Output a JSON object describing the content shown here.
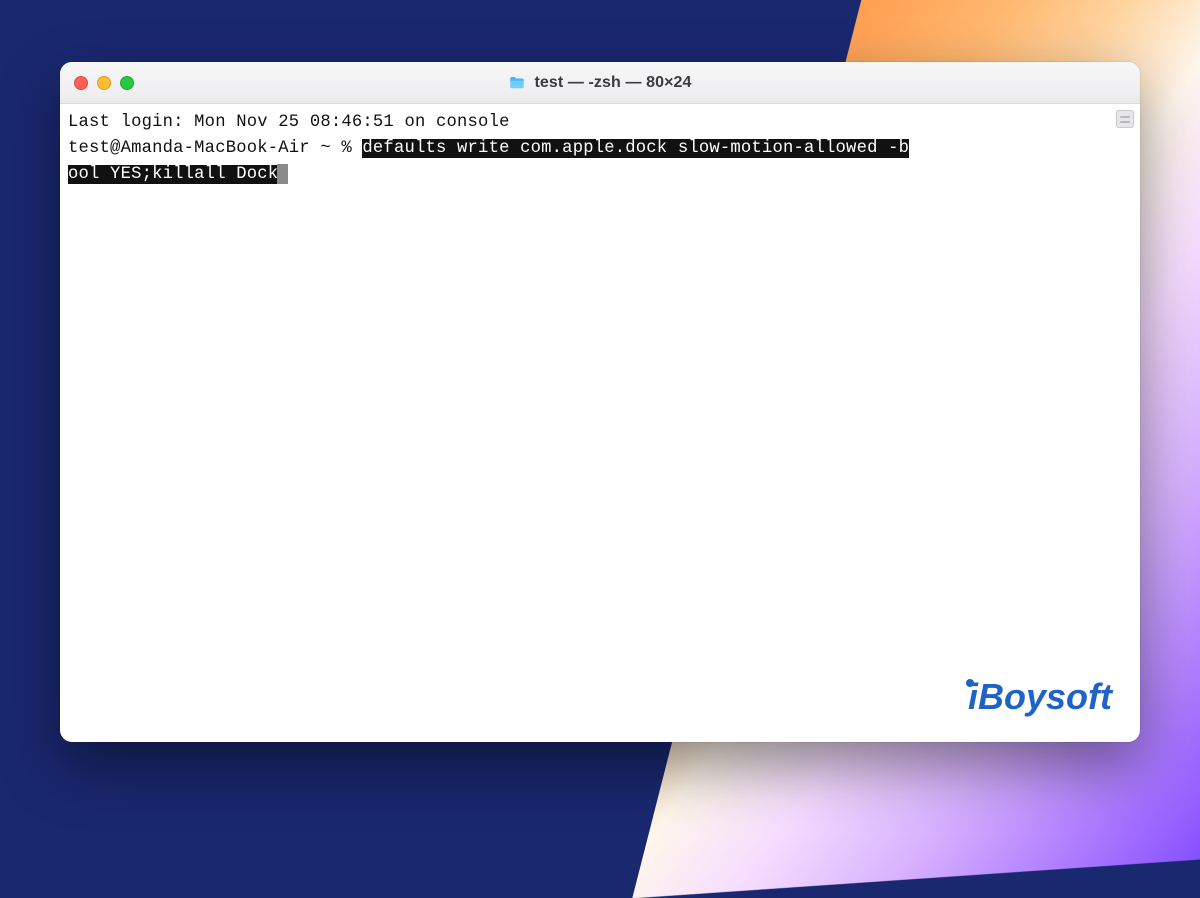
{
  "window": {
    "title": "test — -zsh — 80×24",
    "folder_icon": "folder-icon"
  },
  "terminal": {
    "last_login_line": "Last login: Mon Nov 25 08:46:51 on console",
    "prompt": "test@Amanda-MacBook-Air ~ % ",
    "command_selected_part1": "defaults write com.apple.dock slow-motion-allowed -b",
    "command_selected_part2": "ool YES;killall Dock"
  },
  "watermark": {
    "text": "iBoysoft"
  },
  "colors": {
    "selection_bg": "#111111",
    "selection_fg": "#ffffff",
    "window_bg": "#ffffff",
    "desktop_bg": "#1a2870"
  }
}
